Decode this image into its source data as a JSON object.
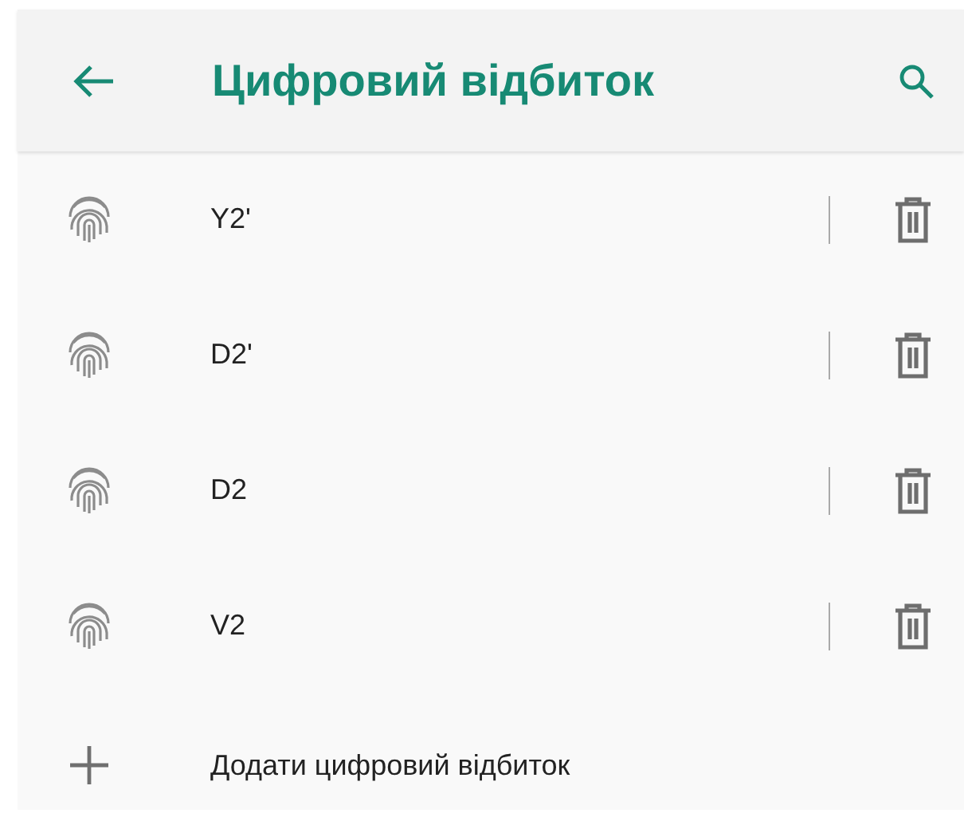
{
  "app_bar": {
    "title": "Цифровий відбиток"
  },
  "fingerprints": [
    {
      "name": "Y2'"
    },
    {
      "name": "D2'"
    },
    {
      "name": "D2"
    },
    {
      "name": "V2"
    }
  ],
  "add_item": {
    "label": "Додати цифровий відбиток"
  }
}
